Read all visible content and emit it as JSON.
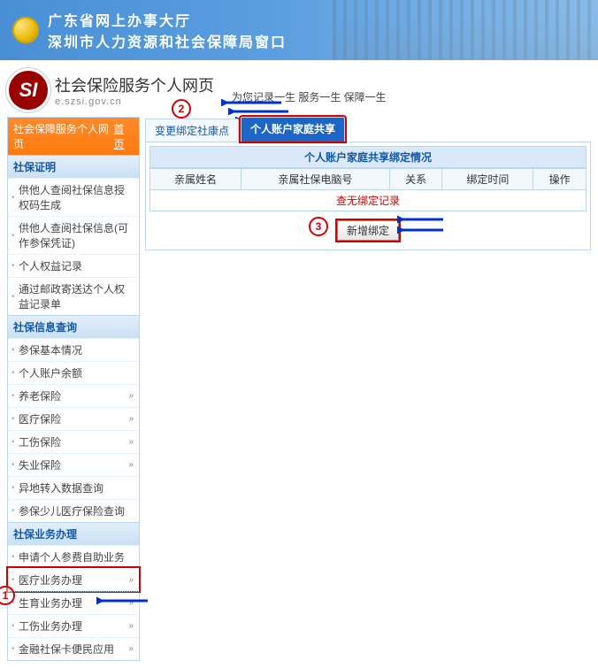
{
  "banner": {
    "line1": "广东省网上办事大厅",
    "line2": "深圳市人力资源和社会保障局窗口"
  },
  "subhead": {
    "logo_text": "SI",
    "title": "社会保险服务个人网页",
    "url": "e.szsi.gov.cn",
    "slogan": "为您记录一生  服务一生  保障一生"
  },
  "annotations": {
    "c1": "1",
    "c2": "2",
    "c3": "3"
  },
  "sidebar": {
    "top_label": "社会保障服务个人网页",
    "top_home": "首页",
    "groups": [
      {
        "title": "社保证明",
        "items": [
          "供他人查阅社保信息授权码生成",
          "供他人查阅社保信息(可作参保凭证)",
          "个人权益记录",
          "通过邮政寄送达个人权益记录单"
        ]
      },
      {
        "title": "社保信息查询",
        "items": [
          "参保基本情况",
          "个人账户余额",
          "养老保险",
          "医疗保险",
          "工伤保险",
          "失业保险",
          "异地转入数据查询",
          "参保少儿医疗保险查询"
        ]
      },
      {
        "title": "社保业务办理",
        "items": [
          "申请个人参费自助业务",
          "医疗业务办理",
          "生育业务办理",
          "工伤业务办理",
          "金融社保卡便民应用"
        ]
      }
    ]
  },
  "main": {
    "tabs": [
      {
        "label": "变更绑定社康点",
        "active": false
      },
      {
        "label": "个人账户家庭共享",
        "active": true
      }
    ],
    "panel_title": "个人账户家庭共享绑定情况",
    "columns": [
      "亲属姓名",
      "亲属社保电脑号",
      "关系",
      "绑定时间",
      "操作"
    ],
    "empty_text": "查无绑定记录",
    "add_button": "新增绑定"
  }
}
